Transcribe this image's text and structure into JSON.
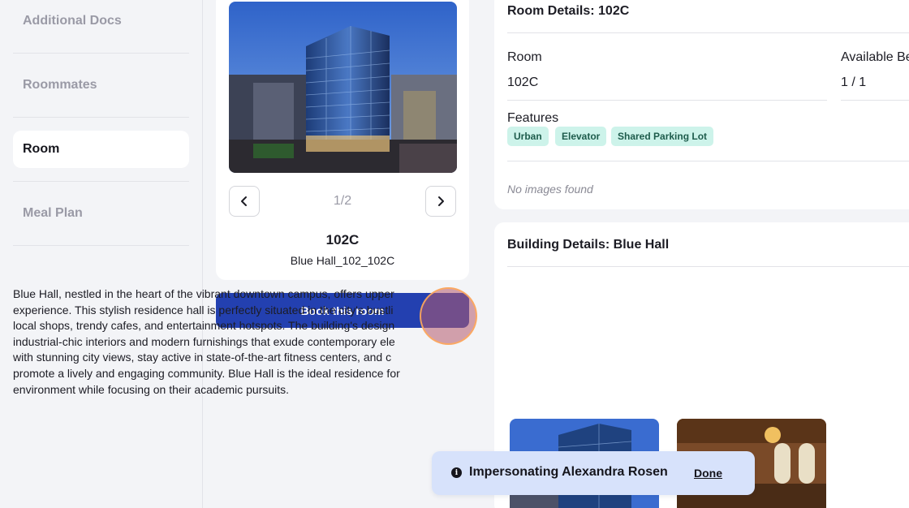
{
  "sidebar": {
    "items": [
      {
        "label": "Additional Docs"
      },
      {
        "label": "Roommates"
      },
      {
        "label": "Room"
      },
      {
        "label": "Meal Plan"
      }
    ]
  },
  "room_card": {
    "pager": "1/2",
    "room_name": "102C",
    "room_sub": "Blue Hall_102_102C",
    "book_label": "Book this room"
  },
  "room_details": {
    "title": "Room Details: 102C",
    "room_label": "Room",
    "room_value": "102C",
    "beds_label": "Available Be",
    "beds_value": "1 / 1",
    "features_label": "Features",
    "features": [
      "Urban",
      "Elevator",
      "Shared Parking Lot"
    ],
    "no_images": "No images found"
  },
  "building_details": {
    "title": "Building Details: Blue Hall",
    "description_lines": [
      "Blue Hall, nestled in the heart of the vibrant downtown campus, offers upper",
      "experience. This stylish residence hall is perfectly situated in the city's bustli",
      "local shops, trendy cafes, and entertainment hotspots. The building's design",
      "industrial-chic interiors and modern furnishings that exude contemporary ele",
      "with stunning city views, stay active in state-of-the-art fitness centers, and c",
      "promote a lively and engaging community. Blue Hall is the ideal residence for",
      "environment while focusing on their academic pursuits."
    ]
  },
  "toast": {
    "icon": "info-icon",
    "message": "Impersonating Alexandra Rosen",
    "done_label": "Done"
  },
  "colors": {
    "primary": "#2340b0",
    "chip_bg": "#cdf3ea",
    "toast_bg": "#d7e2fb"
  }
}
